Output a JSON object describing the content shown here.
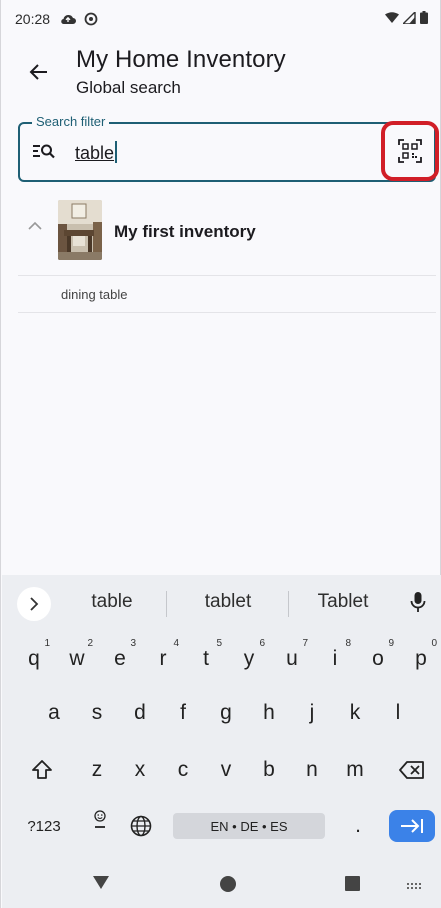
{
  "status": {
    "time": "20:28"
  },
  "appbar": {
    "title": "My Home Inventory",
    "subtitle": "Global search"
  },
  "search": {
    "label": "Search filter",
    "value": "table"
  },
  "inventory": {
    "name": "My first inventory",
    "items": [
      "dining table"
    ]
  },
  "keyboard": {
    "suggestions": [
      "table",
      "tablet",
      "Tablet"
    ],
    "row1": [
      "q",
      "w",
      "e",
      "r",
      "t",
      "y",
      "u",
      "i",
      "o",
      "p"
    ],
    "row1_hints": [
      "1",
      "2",
      "3",
      "4",
      "5",
      "6",
      "7",
      "8",
      "9",
      "0"
    ],
    "row2": [
      "a",
      "s",
      "d",
      "f",
      "g",
      "h",
      "j",
      "k",
      "l"
    ],
    "row3": [
      "z",
      "x",
      "c",
      "v",
      "b",
      "n",
      "m"
    ],
    "symbols_label": "?123",
    "space_label": "EN • DE • ES",
    "period": "."
  },
  "colors": {
    "accent": "#1e5f74",
    "highlight": "#d11e27",
    "enter": "#3b82e8"
  }
}
